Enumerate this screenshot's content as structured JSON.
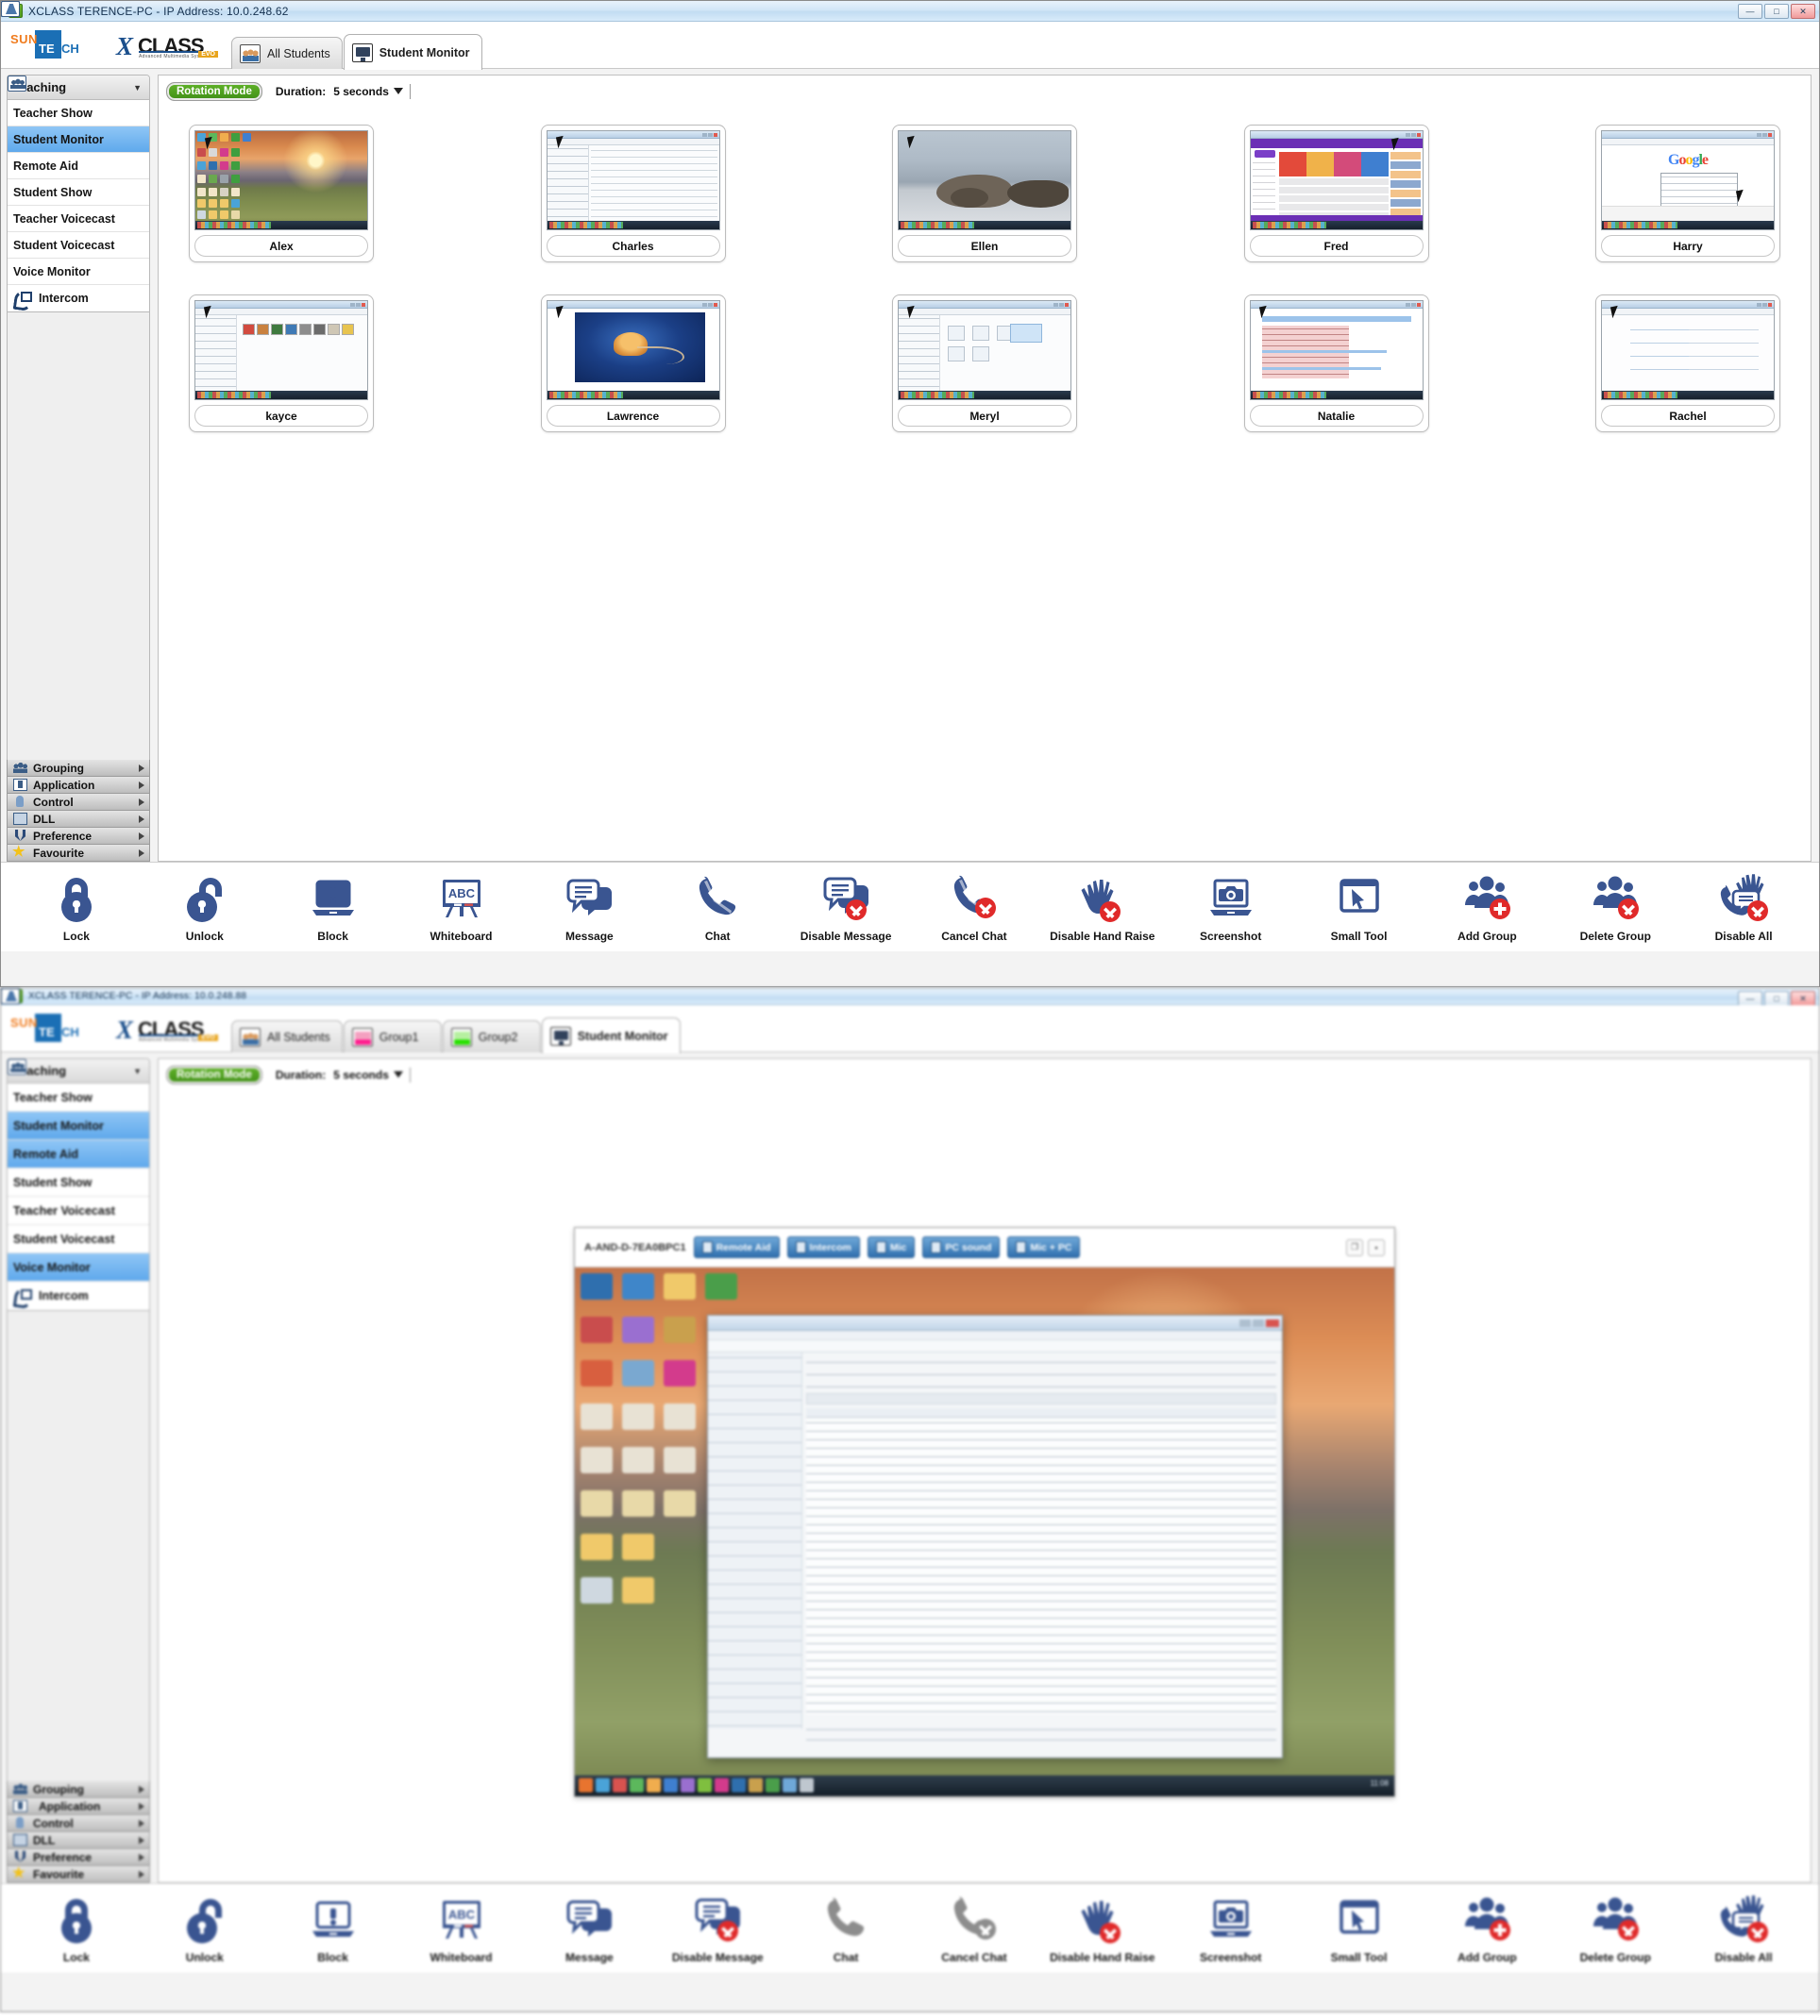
{
  "window1": {
    "titlebar": {
      "title": "XCLASS TERENCE-PC  -  IP Address: 10.0.248.62",
      "icon": "app-icon",
      "minimize": "—",
      "maximize": "□",
      "close": "✕"
    },
    "logo": {
      "sun": "SUN",
      "te": "TE",
      "ch": "CH",
      "x": "X",
      "class": "CLASS",
      "sub": "Advanced Multimedia System",
      "evo": "EVO"
    },
    "tabs": [
      {
        "label": "All Students",
        "icon": "students-icon",
        "active": false
      },
      {
        "label": "Student Monitor",
        "icon": "monitor-icon",
        "active": true
      }
    ],
    "sidebar": {
      "header": {
        "label": "Teaching",
        "icon": "teaching-icon",
        "caret": "▼"
      },
      "items": [
        {
          "label": "Teacher Show",
          "icon": "teacher-show-icon",
          "active": false
        },
        {
          "label": "Student Monitor",
          "icon": "student-monitor-icon",
          "active": true
        },
        {
          "label": "Remote Aid",
          "icon": "remote-aid-icon",
          "active": false
        },
        {
          "label": "Student Show",
          "icon": "student-show-icon",
          "active": false
        },
        {
          "label": "Teacher Voicecast",
          "icon": "teacher-voicecast-icon",
          "active": false
        },
        {
          "label": "Student Voicecast",
          "icon": "student-voicecast-icon",
          "active": false
        },
        {
          "label": "Voice Monitor",
          "icon": "voice-monitor-icon",
          "active": false
        },
        {
          "label": "Intercom",
          "icon": "intercom-icon",
          "active": false
        }
      ],
      "categories": [
        {
          "label": "Grouping",
          "icon": "grouping-icon"
        },
        {
          "label": "Application",
          "icon": "application-icon"
        },
        {
          "label": "Control",
          "icon": "control-icon"
        },
        {
          "label": "DLL",
          "icon": "dll-icon"
        },
        {
          "label": "Preference",
          "icon": "preference-icon"
        },
        {
          "label": "Favourite",
          "icon": "favourite-icon"
        }
      ]
    },
    "toolbar": {
      "rotation_mode": "Rotation Mode",
      "duration_label": "Duration:",
      "duration_value": "5 seconds",
      "duration_caret": "▼"
    },
    "students": [
      {
        "name": "Alex",
        "screen": "desktop-sunset"
      },
      {
        "name": "Charles",
        "screen": "explorer-window"
      },
      {
        "name": "Ellen",
        "screen": "seals-photo"
      },
      {
        "name": "Fred",
        "screen": "yahoo-browser"
      },
      {
        "name": "Harry",
        "screen": "google-browser"
      },
      {
        "name": "kayce",
        "screen": "explorer-pictures"
      },
      {
        "name": "Lawrence",
        "screen": "jellyfish-photo"
      },
      {
        "name": "Meryl",
        "screen": "explorer-devices"
      },
      {
        "name": "Natalie",
        "screen": "spreadsheet"
      },
      {
        "name": "Rachel",
        "screen": "control-panel"
      }
    ],
    "actions": [
      {
        "label": "Lock",
        "icon": "lock-closed-icon",
        "disabled": false
      },
      {
        "label": "Unlock",
        "icon": "lock-open-icon",
        "disabled": false
      },
      {
        "label": "Block",
        "icon": "block-laptop-icon",
        "disabled": false
      },
      {
        "label": "Whiteboard",
        "icon": "whiteboard-icon",
        "disabled": false
      },
      {
        "label": "Message",
        "icon": "message-bubbles-icon",
        "disabled": false
      },
      {
        "label": "Chat",
        "icon": "phone-icon",
        "disabled": false
      },
      {
        "label": "Disable Message",
        "icon": "message-disabled-icon",
        "disabled": false
      },
      {
        "label": "Cancel Chat",
        "icon": "phone-cancel-icon",
        "disabled": false
      },
      {
        "label": "Disable Hand Raise",
        "icon": "hand-raise-disabled-icon",
        "disabled": false
      },
      {
        "label": "Screenshot",
        "icon": "screenshot-camera-icon",
        "disabled": false
      },
      {
        "label": "Small Tool",
        "icon": "small-tool-cursor-icon",
        "disabled": false
      },
      {
        "label": "Add Group",
        "icon": "add-group-icon",
        "disabled": false
      },
      {
        "label": "Delete Group",
        "icon": "delete-group-icon",
        "disabled": false
      },
      {
        "label": "Disable All",
        "icon": "disable-all-icon",
        "disabled": false
      }
    ]
  },
  "window2": {
    "titlebar": {
      "title": "XCLASS TERENCE-PC  -  IP Address: 10.0.248.88",
      "icon": "app-icon",
      "minimize": "—",
      "maximize": "□",
      "close": "✕"
    },
    "logo": {
      "sun": "SUN",
      "te": "TE",
      "ch": "CH",
      "x": "X",
      "class": "CLASS",
      "sub": "Advanced Multimedia System",
      "evo": "EVO"
    },
    "tabs": [
      {
        "label": "All Students",
        "icon": "students-icon",
        "active": false
      },
      {
        "label": "Group1",
        "icon": "group1-icon",
        "active": false
      },
      {
        "label": "Group2",
        "icon": "group2-icon",
        "active": false
      },
      {
        "label": "Student Monitor",
        "icon": "monitor-icon",
        "active": true
      }
    ],
    "sidebar": {
      "header": {
        "label": "Teaching",
        "icon": "teaching-icon",
        "caret": "▼"
      },
      "items": [
        {
          "label": "Teacher Show",
          "icon": "teacher-show-icon",
          "active": false
        },
        {
          "label": "Student Monitor",
          "icon": "student-monitor-icon",
          "active": true
        },
        {
          "label": "Remote Aid",
          "icon": "remote-aid-icon",
          "active": true
        },
        {
          "label": "Student Show",
          "icon": "student-show-icon",
          "active": false
        },
        {
          "label": "Teacher Voicecast",
          "icon": "teacher-voicecast-icon",
          "active": false
        },
        {
          "label": "Student Voicecast",
          "icon": "student-voicecast-icon",
          "active": false
        },
        {
          "label": "Voice Monitor",
          "icon": "voice-monitor-icon",
          "active": true
        },
        {
          "label": "Intercom",
          "icon": "intercom-icon",
          "active": false
        }
      ],
      "categories": [
        {
          "label": "Grouping",
          "icon": "grouping-icon"
        },
        {
          "label": "Application",
          "icon": "application-icon"
        },
        {
          "label": "Control",
          "icon": "control-icon"
        },
        {
          "label": "DLL",
          "icon": "dll-icon"
        },
        {
          "label": "Preference",
          "icon": "preference-icon"
        },
        {
          "label": "Favourite",
          "icon": "favourite-icon"
        }
      ]
    },
    "toolbar": {
      "rotation_mode": "Rotation Mode",
      "duration_label": "Duration:",
      "duration_value": "5 seconds",
      "duration_caret": "▼"
    },
    "remote": {
      "host": "A-AND-D-7EA0BPC1",
      "buttons": [
        {
          "label": "Remote Aid",
          "icon": "remote-aid-icon"
        },
        {
          "label": "Intercom",
          "icon": "intercom-icon"
        },
        {
          "label": "Mic",
          "icon": "mic-icon"
        },
        {
          "label": "PC sound",
          "icon": "pc-sound-icon"
        },
        {
          "label": "Mic + PC",
          "icon": "mic-pc-icon"
        }
      ],
      "restore": "❐",
      "close": "▪",
      "desktop": "remote-desktop-sunset",
      "inner_window": "programs-and-features",
      "taskbar_clock": "11:08"
    },
    "actions": [
      {
        "label": "Lock",
        "icon": "lock-closed-icon",
        "disabled": false
      },
      {
        "label": "Unlock",
        "icon": "lock-open-icon",
        "disabled": false
      },
      {
        "label": "Block",
        "icon": "block-laptop-icon",
        "disabled": false
      },
      {
        "label": "Whiteboard",
        "icon": "whiteboard-icon",
        "disabled": false
      },
      {
        "label": "Message",
        "icon": "message-bubbles-icon",
        "disabled": false
      },
      {
        "label": "Disable Message",
        "icon": "message-disabled-icon",
        "disabled": false
      },
      {
        "label": "Chat",
        "icon": "phone-icon",
        "disabled": true
      },
      {
        "label": "Cancel Chat",
        "icon": "phone-cancel-icon",
        "disabled": true
      },
      {
        "label": "Disable Hand Raise",
        "icon": "hand-raise-disabled-icon",
        "disabled": false
      },
      {
        "label": "Screenshot",
        "icon": "screenshot-camera-icon",
        "disabled": false
      },
      {
        "label": "Small Tool",
        "icon": "small-tool-cursor-icon",
        "disabled": false
      },
      {
        "label": "Add Group",
        "icon": "add-group-icon",
        "disabled": false
      },
      {
        "label": "Delete Group",
        "icon": "delete-group-icon",
        "disabled": false
      },
      {
        "label": "Disable All",
        "icon": "disable-all-icon",
        "disabled": false
      }
    ]
  },
  "colors": {
    "icon_blue": "#3a5591",
    "icon_red": "#e02a2a",
    "icon_gray": "#8d8d8d",
    "rotation_green": "#4e9c20",
    "selection_blue": "#5fa9ec"
  }
}
